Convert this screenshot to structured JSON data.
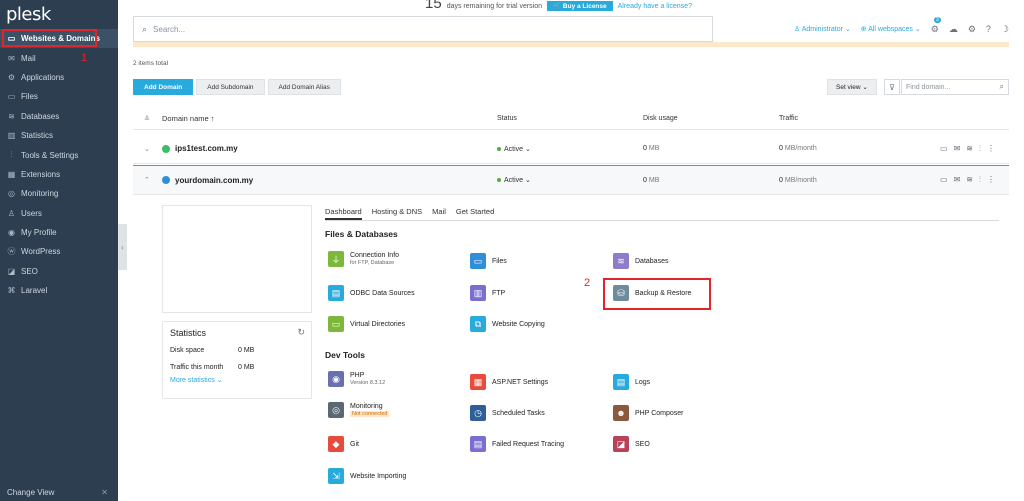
{
  "app": {
    "logo": "plesk"
  },
  "trial": {
    "days": "15",
    "text": "days remaining for trial version",
    "buy_label": "Buy a License",
    "license_link": "Already have a license?"
  },
  "sidebar": {
    "items": [
      {
        "label": "Websites & Domains",
        "icon": "monitor-icon",
        "glyph": "▭"
      },
      {
        "label": "Mail",
        "icon": "envelope-icon",
        "glyph": "✉"
      },
      {
        "label": "Applications",
        "icon": "gear-icon",
        "glyph": "⚙"
      },
      {
        "label": "Files",
        "icon": "folder-icon",
        "glyph": "▭"
      },
      {
        "label": "Databases",
        "icon": "database-icon",
        "glyph": "≋"
      },
      {
        "label": "Statistics",
        "icon": "bar-chart-icon",
        "glyph": "▥"
      },
      {
        "label": "Tools & Settings",
        "icon": "sliders-icon",
        "glyph": "⫶"
      },
      {
        "label": "Extensions",
        "icon": "grid-icon",
        "glyph": "▦"
      },
      {
        "label": "Monitoring",
        "icon": "monitoring-icon",
        "glyph": "◎"
      },
      {
        "label": "Users",
        "icon": "user-icon",
        "glyph": "♙"
      },
      {
        "label": "My Profile",
        "icon": "profile-icon",
        "glyph": "◉"
      },
      {
        "label": "WordPress",
        "icon": "wordpress-icon",
        "glyph": "ⓦ"
      },
      {
        "label": "SEO",
        "icon": "seo-icon",
        "glyph": "◪"
      },
      {
        "label": "Laravel",
        "icon": "laravel-icon",
        "glyph": "⌘"
      }
    ],
    "change_view": "Change View",
    "step_marker": "1"
  },
  "topbar": {
    "search_placeholder": "Search...",
    "user": "Administrator ⌄",
    "webspaces": "All webspaces ⌄",
    "notif_count": "3"
  },
  "list": {
    "items_total": "2 items total",
    "buttons": {
      "add_domain": "Add Domain",
      "add_subdomain": "Add Subdomain",
      "add_alias": "Add Domain Alias"
    },
    "set_view": "Set view ⌄",
    "find_placeholder": "Find domain...",
    "headers": {
      "name": "Domain name ↑",
      "status": "Status",
      "disk": "Disk usage",
      "traffic": "Traffic"
    },
    "rows": [
      {
        "name": "ips1test.com.my",
        "status": "Active ⌄",
        "disk_val": "0",
        "disk_unit": "MB",
        "traffic_val": "0",
        "traffic_unit": "MB/month",
        "color": "#3dbb6c"
      },
      {
        "name": "yourdomain.com.my",
        "status": "Active ⌄",
        "disk_val": "0",
        "disk_unit": "MB",
        "traffic_val": "0",
        "traffic_unit": "MB/month",
        "color": "#2f8fd8"
      }
    ]
  },
  "panel": {
    "tabs": [
      "Dashboard",
      "Hosting & DNS",
      "Mail",
      "Get Started"
    ],
    "stats": {
      "title": "Statistics",
      "disk_label": "Disk space",
      "disk_val": "0 MB",
      "traffic_label": "Traffic this month",
      "traffic_val": "0 MB",
      "more": "More statistics ⌄"
    },
    "files_db_title": "Files & Databases",
    "dev_tools_title": "Dev Tools",
    "tiles": {
      "connection_info": {
        "label": "Connection Info",
        "sub": "for FTP, Database"
      },
      "files": "Files",
      "databases": "Databases",
      "odbc": "ODBC Data Sources",
      "ftp": "FTP",
      "backup": "Backup & Restore",
      "virtual_dirs": "Virtual Directories",
      "website_copying": "Website Copying",
      "php": {
        "label": "PHP",
        "sub": "Version 8.3.12"
      },
      "aspnet": "ASP.NET Settings",
      "logs": "Logs",
      "monitoring": {
        "label": "Monitoring",
        "status": "Not connected"
      },
      "scheduled": "Scheduled Tasks",
      "composer": "PHP Composer",
      "git": "Git",
      "failed_req": "Failed Request Tracing",
      "seo": "SEO",
      "importing": "Website Importing"
    },
    "step_marker": "2"
  }
}
